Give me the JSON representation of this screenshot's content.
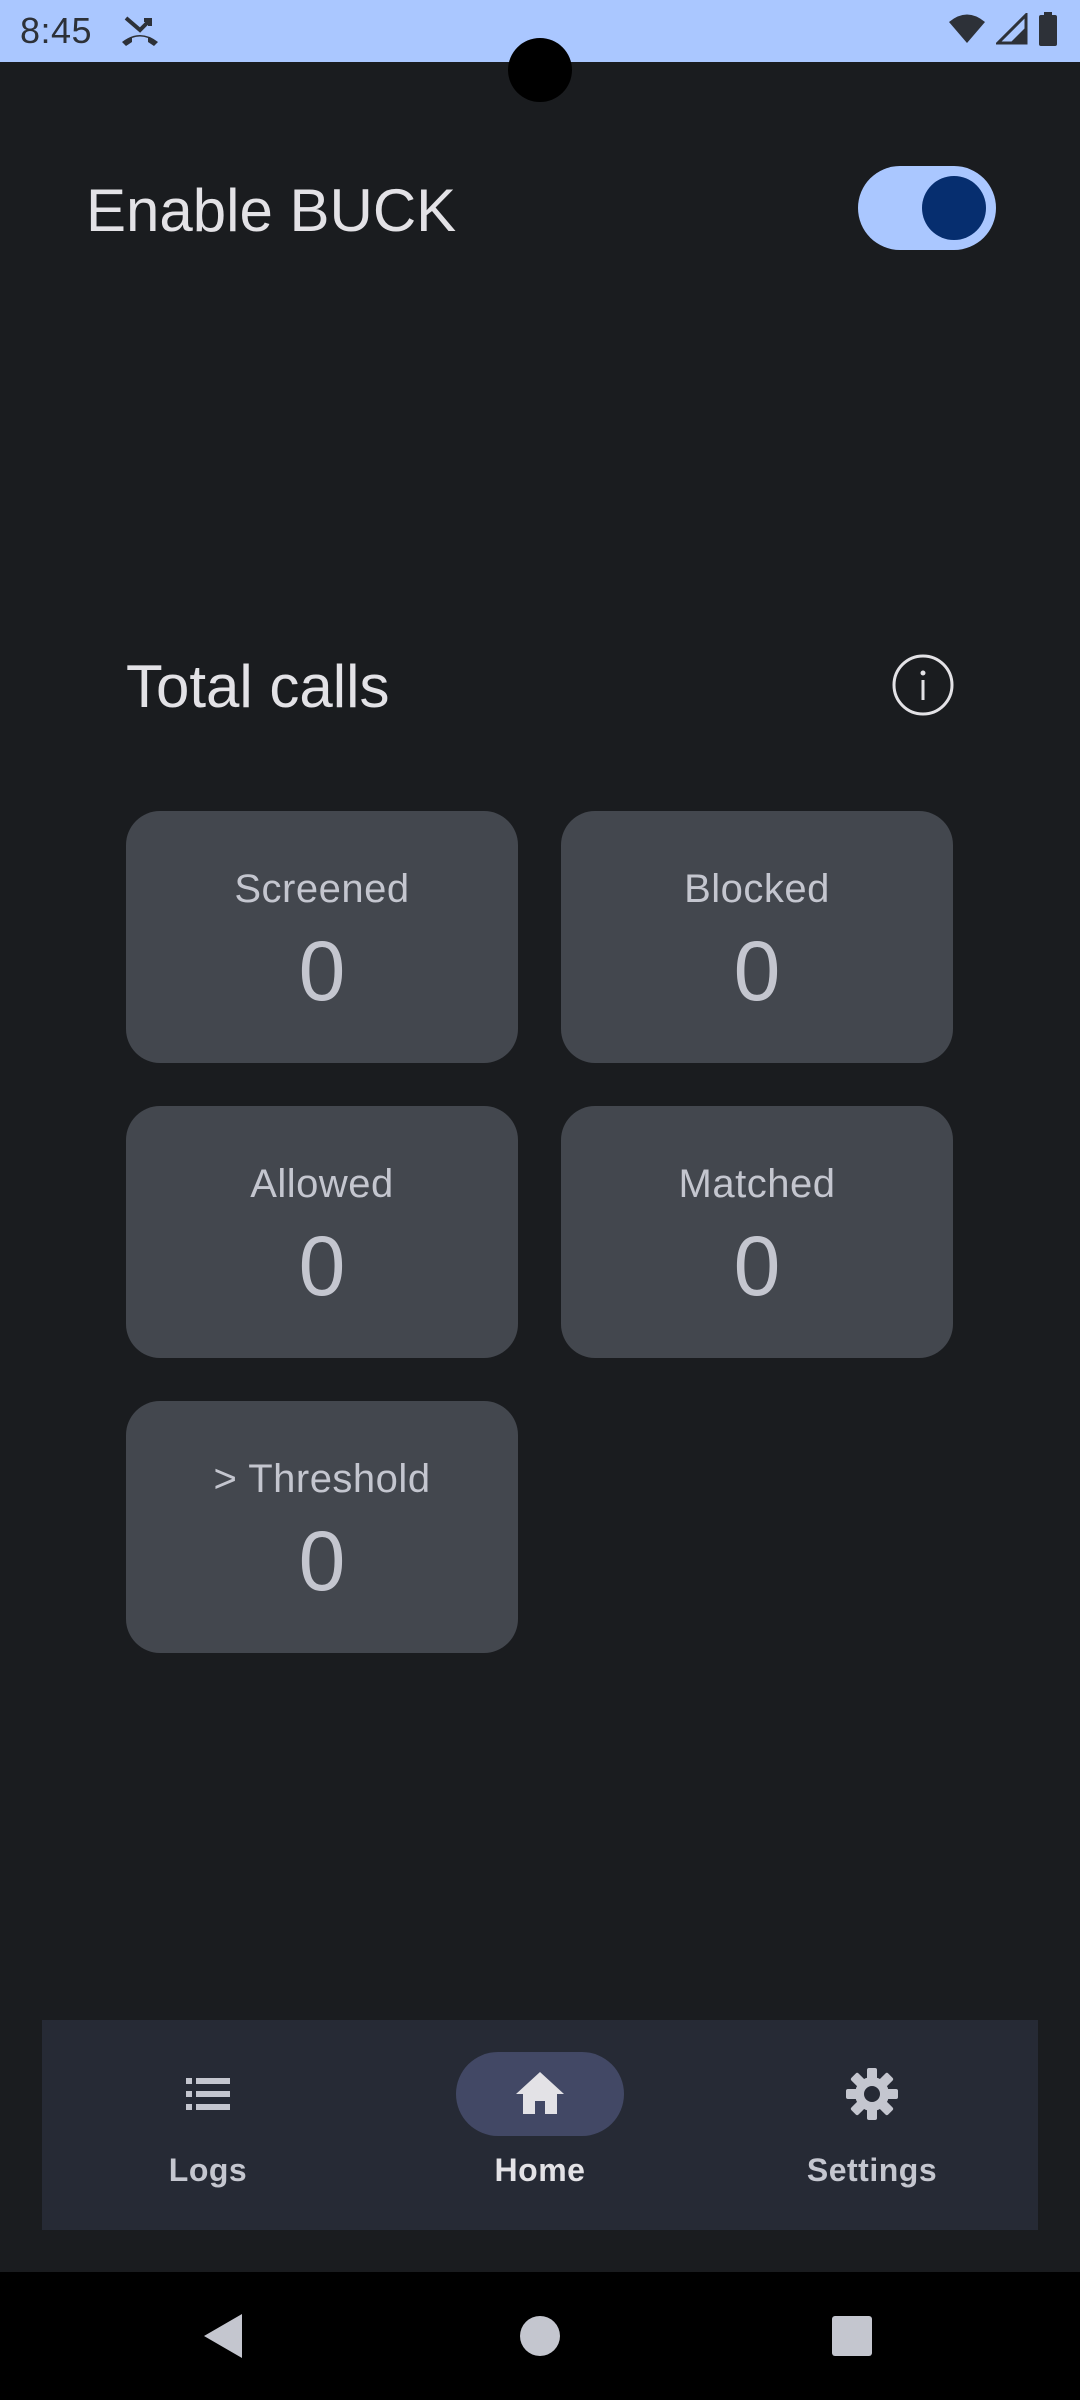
{
  "status_bar": {
    "time": "8:45",
    "icons": [
      "missed-call-icon",
      "wifi-icon",
      "signal-icon",
      "battery-icon"
    ],
    "background": "#aac7ff"
  },
  "header": {
    "title": "Enable BUCK",
    "toggle_on": true
  },
  "stats": {
    "title": "Total calls",
    "info_icon": "info-icon",
    "cards": [
      {
        "label": "Screened",
        "value": "0"
      },
      {
        "label": "Blocked",
        "value": "0"
      },
      {
        "label": "Allowed",
        "value": "0"
      },
      {
        "label": "Matched",
        "value": "0"
      },
      {
        "label": "> Threshold",
        "value": "0"
      }
    ]
  },
  "bottom_nav": {
    "items": [
      {
        "label": "Logs",
        "icon": "list-icon",
        "active": false
      },
      {
        "label": "Home",
        "icon": "home-icon",
        "active": true
      },
      {
        "label": "Settings",
        "icon": "gear-icon",
        "active": false
      }
    ]
  },
  "system_nav": {
    "buttons": [
      "back-icon",
      "home-circle-icon",
      "recents-icon"
    ]
  },
  "colors": {
    "background": "#1a1c1f",
    "card": "#43474e",
    "accent": "#aac7ff",
    "toggle_knob": "#062e6f",
    "nav_bg": "#262a35",
    "nav_active_pill": "#424865"
  }
}
